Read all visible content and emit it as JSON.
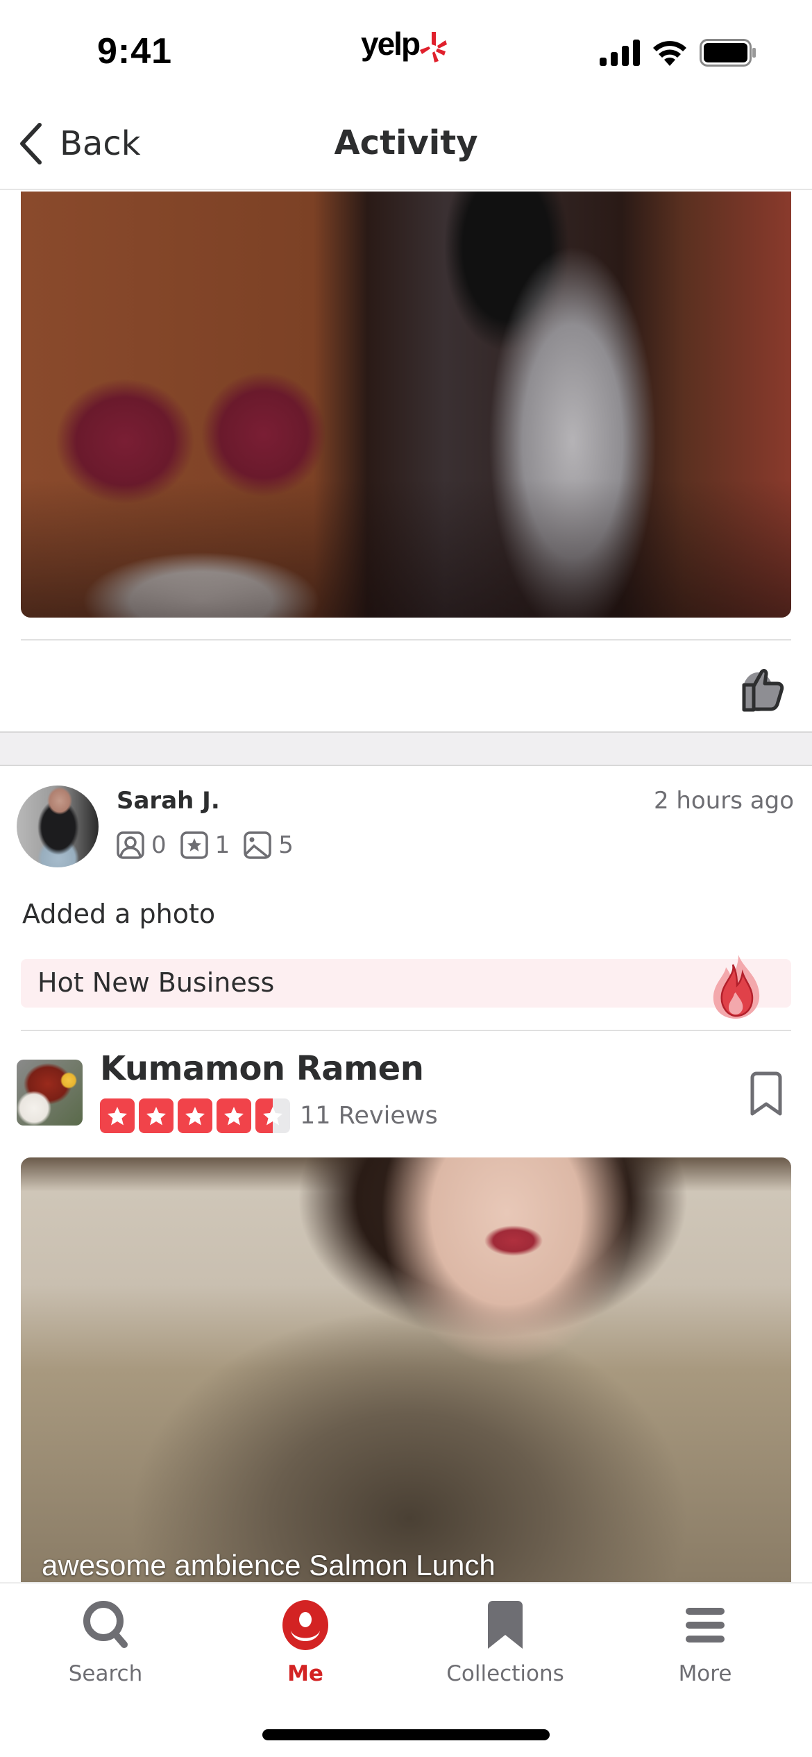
{
  "status_bar": {
    "time": "9:41",
    "logo_text": "yelp",
    "icons": [
      "cellular-signal-icon",
      "wifi-icon",
      "battery-icon"
    ]
  },
  "nav": {
    "back_label": "Back",
    "title": "Activity"
  },
  "feed": {
    "previous_item": {
      "photo_alt": "Person in silver outfit standing by a red drum kit in a music studio",
      "like_icon": "thumbs-up-icon"
    },
    "activity": {
      "user": {
        "name": "Sarah J.",
        "friends_count": "0",
        "reviews_count": "1",
        "photos_count": "5"
      },
      "time_ago": "2 hours ago",
      "action_text": "Added a photo",
      "badge": {
        "label": "Hot New Business",
        "icon": "flame-icon",
        "color": "#e04149",
        "background": "#fdeff1"
      },
      "business": {
        "name": "Kumamon Ramen",
        "rating": 4.5,
        "rating_max": 5,
        "review_count_label": "11 Reviews",
        "star_color": "#f1434a"
      },
      "photo_caption": "awesome ambience Salmon Lunch"
    }
  },
  "tab_bar": {
    "active": "Me",
    "accent_color": "#d32323",
    "tabs": [
      {
        "label": "Search",
        "icon": "search-icon"
      },
      {
        "label": "Me",
        "icon": "profile-icon"
      },
      {
        "label": "Collections",
        "icon": "bookmark-icon"
      },
      {
        "label": "More",
        "icon": "menu-icon"
      }
    ]
  }
}
